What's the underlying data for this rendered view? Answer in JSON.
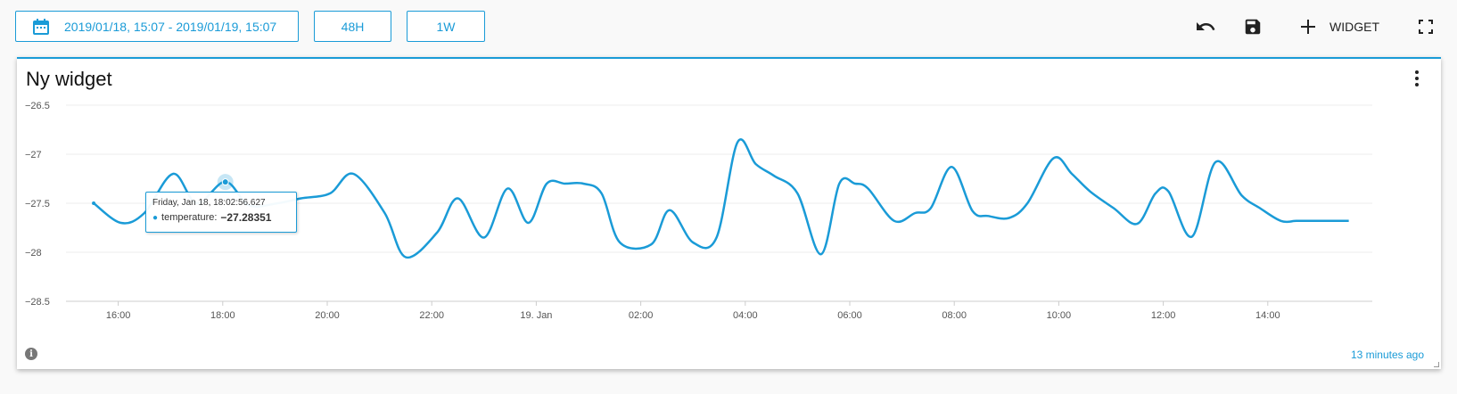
{
  "toolbar": {
    "date_range": "2019/01/18, 15:07 - 2019/01/19, 15:07",
    "btn_48h": "48H",
    "btn_1w": "1W",
    "widget_label": "WIDGET",
    "icons": [
      "calendar-icon",
      "undo-icon",
      "save-icon",
      "plus-icon",
      "fullscreen-icon"
    ]
  },
  "widget": {
    "title": "Ny widget",
    "updated": "13 minutes ago",
    "info_glyph": "i"
  },
  "tooltip": {
    "date": "Friday, Jan 18, 18:02:56.627",
    "series": "temperature:",
    "value": "−27.28351"
  },
  "colors": {
    "accent": "#1a9bd7",
    "line": "#1a9bd7"
  },
  "chart_data": {
    "type": "line",
    "title": "",
    "xlabel": "",
    "ylabel": "",
    "ylim": [
      -28.5,
      -26.5
    ],
    "y_ticks": [
      "−26.5",
      "−27",
      "−27.5",
      "−28",
      "−28.5"
    ],
    "x_ticks": [
      "16:00",
      "18:00",
      "20:00",
      "22:00",
      "19. Jan",
      "02:00",
      "04:00",
      "06:00",
      "08:00",
      "10:00",
      "12:00",
      "14:00"
    ],
    "x_unit": "hours since 2019-01-18 15:00",
    "series": [
      {
        "name": "temperature",
        "x": [
          0.53,
          1.05,
          1.5,
          2.05,
          2.5,
          3.05,
          3.5,
          4.05,
          4.5,
          5.05,
          5.5,
          6.1,
          6.5,
          7.1,
          7.5,
          8.0,
          8.45,
          8.85,
          9.2,
          9.55,
          9.9,
          10.25,
          10.6,
          11.2,
          11.55,
          12.0,
          12.45,
          12.85,
          13.2,
          13.55,
          14.0,
          14.45,
          14.8,
          15.1,
          15.35,
          15.85,
          16.25,
          16.55,
          16.95,
          17.35,
          17.65,
          18.05,
          18.4,
          18.9,
          19.25,
          19.6,
          20.05,
          20.5,
          20.85,
          21.1,
          21.55,
          22.0,
          22.5,
          22.85,
          23.25,
          23.55,
          23.85,
          24.15,
          24.55
        ],
        "y": [
          -27.5,
          -27.7,
          -27.6,
          -27.2,
          -27.5,
          -27.28,
          -27.52,
          -27.5,
          -27.45,
          -27.4,
          -27.2,
          -27.6,
          -28.05,
          -27.8,
          -27.45,
          -27.85,
          -27.35,
          -27.7,
          -27.3,
          -27.3,
          -27.3,
          -27.4,
          -27.9,
          -27.92,
          -27.57,
          -27.9,
          -27.85,
          -26.88,
          -27.1,
          -27.22,
          -27.4,
          -28.02,
          -27.3,
          -27.3,
          -27.35,
          -27.68,
          -27.6,
          -27.55,
          -27.13,
          -27.58,
          -27.63,
          -27.65,
          -27.5,
          -27.04,
          -27.2,
          -27.38,
          -27.55,
          -27.71,
          -27.4,
          -27.38,
          -27.84,
          -27.08,
          -27.42,
          -27.55,
          -27.68,
          -27.68,
          -27.68,
          -27.68,
          -27.68
        ]
      }
    ],
    "grid": true,
    "legend": "none"
  }
}
